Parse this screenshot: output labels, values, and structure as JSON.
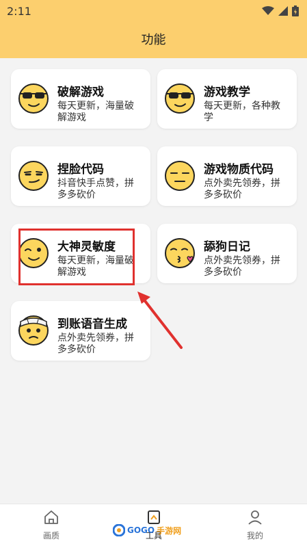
{
  "status_bar": {
    "time": "2:11"
  },
  "header": {
    "title": "功能"
  },
  "cards": [
    {
      "title": "破解游戏",
      "desc": "每天更新，海量破解游戏",
      "icon": "sunglasses-face-icon"
    },
    {
      "title": "游戏教学",
      "desc": "每天更新，各种教学",
      "icon": "sunglasses-face-icon"
    },
    {
      "title": "捏脸代码",
      "desc": "抖音快手点赞，拼多多砍价",
      "icon": "smirking-face-icon"
    },
    {
      "title": "游戏物质代码",
      "desc": "点外卖先领券，拼多多砍价",
      "icon": "expressionless-face-icon"
    },
    {
      "title": "大神灵敏度",
      "desc": "每天更新，海量破解游戏",
      "icon": "winking-face-icon"
    },
    {
      "title": "舔狗日记",
      "desc": "点外卖先领券，拼多多砍价",
      "icon": "kissing-face-icon"
    },
    {
      "title": "到账语音生成",
      "desc": "点外卖先领券，拼多多砍价",
      "icon": "bandaged-face-icon"
    }
  ],
  "tabs": [
    {
      "label": "画质",
      "icon": "home-icon"
    },
    {
      "label": "工具",
      "icon": "tools-icon"
    },
    {
      "label": "我的",
      "icon": "user-icon"
    }
  ],
  "watermark": {
    "text_a": "GOGO",
    "text_b": "手游网"
  },
  "colors": {
    "header": "#fccf6e",
    "highlight": "#e0312e",
    "arrow": "#e0312e"
  }
}
